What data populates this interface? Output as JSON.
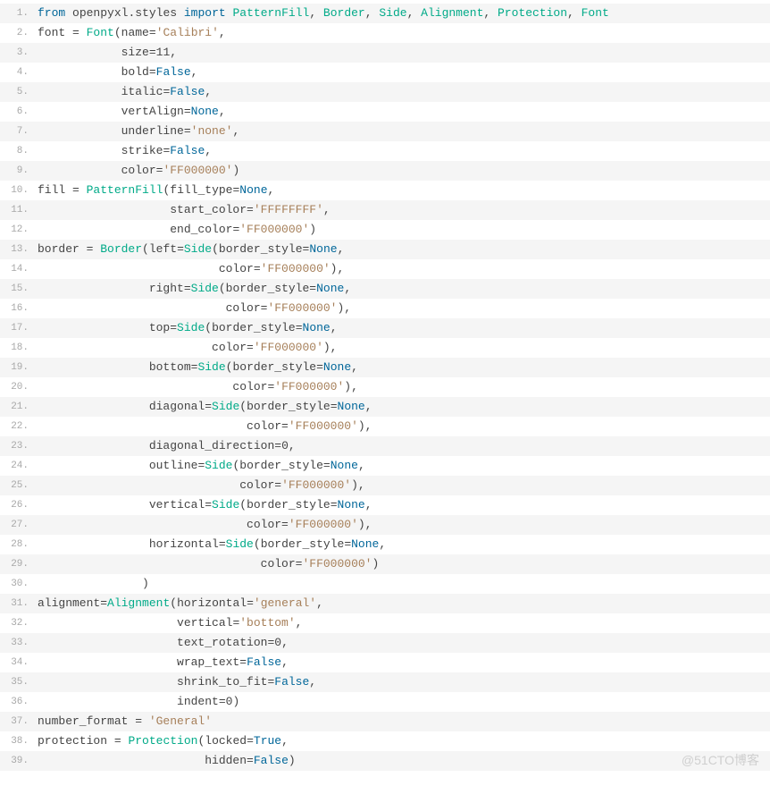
{
  "watermark": "@51CTO博客",
  "lines": [
    [
      [
        "kw",
        "from"
      ],
      [
        "id",
        " openpyxl"
      ],
      [
        "op",
        "."
      ],
      [
        "id",
        "styles "
      ],
      [
        "kw",
        "import"
      ],
      [
        "id",
        " "
      ],
      [
        "cls",
        "PatternFill"
      ],
      [
        "op",
        ", "
      ],
      [
        "cls",
        "Border"
      ],
      [
        "op",
        ", "
      ],
      [
        "cls",
        "Side"
      ],
      [
        "op",
        ", "
      ],
      [
        "cls",
        "Alignment"
      ],
      [
        "op",
        ", "
      ],
      [
        "cls",
        "Protection"
      ],
      [
        "op",
        ", "
      ],
      [
        "cls",
        "Font"
      ]
    ],
    [
      [
        "id",
        "font "
      ],
      [
        "op",
        "= "
      ],
      [
        "cls",
        "Font"
      ],
      [
        "op",
        "("
      ],
      [
        "id",
        "name"
      ],
      [
        "op",
        "="
      ],
      [
        "str",
        "'Calibri'"
      ],
      [
        "op",
        ","
      ]
    ],
    [
      [
        "id",
        "            size"
      ],
      [
        "op",
        "="
      ],
      [
        "num",
        "11"
      ],
      [
        "op",
        ","
      ]
    ],
    [
      [
        "id",
        "            bold"
      ],
      [
        "op",
        "="
      ],
      [
        "bool",
        "False"
      ],
      [
        "op",
        ","
      ]
    ],
    [
      [
        "id",
        "            italic"
      ],
      [
        "op",
        "="
      ],
      [
        "bool",
        "False"
      ],
      [
        "op",
        ","
      ]
    ],
    [
      [
        "id",
        "            vertAlign"
      ],
      [
        "op",
        "="
      ],
      [
        "bool",
        "None"
      ],
      [
        "op",
        ","
      ]
    ],
    [
      [
        "id",
        "            underline"
      ],
      [
        "op",
        "="
      ],
      [
        "str",
        "'none'"
      ],
      [
        "op",
        ","
      ]
    ],
    [
      [
        "id",
        "            strike"
      ],
      [
        "op",
        "="
      ],
      [
        "bool",
        "False"
      ],
      [
        "op",
        ","
      ]
    ],
    [
      [
        "id",
        "            color"
      ],
      [
        "op",
        "="
      ],
      [
        "str",
        "'FF000000'"
      ],
      [
        "op",
        ")"
      ]
    ],
    [
      [
        "id",
        "fill "
      ],
      [
        "op",
        "= "
      ],
      [
        "cls",
        "PatternFill"
      ],
      [
        "op",
        "("
      ],
      [
        "id",
        "fill_type"
      ],
      [
        "op",
        "="
      ],
      [
        "bool",
        "None"
      ],
      [
        "op",
        ","
      ]
    ],
    [
      [
        "id",
        "                   start_color"
      ],
      [
        "op",
        "="
      ],
      [
        "str",
        "'FFFFFFFF'"
      ],
      [
        "op",
        ","
      ]
    ],
    [
      [
        "id",
        "                   end_color"
      ],
      [
        "op",
        "="
      ],
      [
        "str",
        "'FF000000'"
      ],
      [
        "op",
        ")"
      ]
    ],
    [
      [
        "id",
        "border "
      ],
      [
        "op",
        "= "
      ],
      [
        "cls",
        "Border"
      ],
      [
        "op",
        "("
      ],
      [
        "id",
        "left"
      ],
      [
        "op",
        "="
      ],
      [
        "cls",
        "Side"
      ],
      [
        "op",
        "("
      ],
      [
        "id",
        "border_style"
      ],
      [
        "op",
        "="
      ],
      [
        "bool",
        "None"
      ],
      [
        "op",
        ","
      ]
    ],
    [
      [
        "id",
        "                          color"
      ],
      [
        "op",
        "="
      ],
      [
        "str",
        "'FF000000'"
      ],
      [
        "op",
        "),"
      ]
    ],
    [
      [
        "id",
        "                right"
      ],
      [
        "op",
        "="
      ],
      [
        "cls",
        "Side"
      ],
      [
        "op",
        "("
      ],
      [
        "id",
        "border_style"
      ],
      [
        "op",
        "="
      ],
      [
        "bool",
        "None"
      ],
      [
        "op",
        ","
      ]
    ],
    [
      [
        "id",
        "                           color"
      ],
      [
        "op",
        "="
      ],
      [
        "str",
        "'FF000000'"
      ],
      [
        "op",
        "),"
      ]
    ],
    [
      [
        "id",
        "                top"
      ],
      [
        "op",
        "="
      ],
      [
        "cls",
        "Side"
      ],
      [
        "op",
        "("
      ],
      [
        "id",
        "border_style"
      ],
      [
        "op",
        "="
      ],
      [
        "bool",
        "None"
      ],
      [
        "op",
        ","
      ]
    ],
    [
      [
        "id",
        "                         color"
      ],
      [
        "op",
        "="
      ],
      [
        "str",
        "'FF000000'"
      ],
      [
        "op",
        "),"
      ]
    ],
    [
      [
        "id",
        "                bottom"
      ],
      [
        "op",
        "="
      ],
      [
        "cls",
        "Side"
      ],
      [
        "op",
        "("
      ],
      [
        "id",
        "border_style"
      ],
      [
        "op",
        "="
      ],
      [
        "bool",
        "None"
      ],
      [
        "op",
        ","
      ]
    ],
    [
      [
        "id",
        "                            color"
      ],
      [
        "op",
        "="
      ],
      [
        "str",
        "'FF000000'"
      ],
      [
        "op",
        "),"
      ]
    ],
    [
      [
        "id",
        "                diagonal"
      ],
      [
        "op",
        "="
      ],
      [
        "cls",
        "Side"
      ],
      [
        "op",
        "("
      ],
      [
        "id",
        "border_style"
      ],
      [
        "op",
        "="
      ],
      [
        "bool",
        "None"
      ],
      [
        "op",
        ","
      ]
    ],
    [
      [
        "id",
        "                              color"
      ],
      [
        "op",
        "="
      ],
      [
        "str",
        "'FF000000'"
      ],
      [
        "op",
        "),"
      ]
    ],
    [
      [
        "id",
        "                diagonal_direction"
      ],
      [
        "op",
        "="
      ],
      [
        "num",
        "0"
      ],
      [
        "op",
        ","
      ]
    ],
    [
      [
        "id",
        "                outline"
      ],
      [
        "op",
        "="
      ],
      [
        "cls",
        "Side"
      ],
      [
        "op",
        "("
      ],
      [
        "id",
        "border_style"
      ],
      [
        "op",
        "="
      ],
      [
        "bool",
        "None"
      ],
      [
        "op",
        ","
      ]
    ],
    [
      [
        "id",
        "                             color"
      ],
      [
        "op",
        "="
      ],
      [
        "str",
        "'FF000000'"
      ],
      [
        "op",
        "),"
      ]
    ],
    [
      [
        "id",
        "                vertical"
      ],
      [
        "op",
        "="
      ],
      [
        "cls",
        "Side"
      ],
      [
        "op",
        "("
      ],
      [
        "id",
        "border_style"
      ],
      [
        "op",
        "="
      ],
      [
        "bool",
        "None"
      ],
      [
        "op",
        ","
      ]
    ],
    [
      [
        "id",
        "                              color"
      ],
      [
        "op",
        "="
      ],
      [
        "str",
        "'FF000000'"
      ],
      [
        "op",
        "),"
      ]
    ],
    [
      [
        "id",
        "                horizontal"
      ],
      [
        "op",
        "="
      ],
      [
        "cls",
        "Side"
      ],
      [
        "op",
        "("
      ],
      [
        "id",
        "border_style"
      ],
      [
        "op",
        "="
      ],
      [
        "bool",
        "None"
      ],
      [
        "op",
        ","
      ]
    ],
    [
      [
        "id",
        "                                color"
      ],
      [
        "op",
        "="
      ],
      [
        "str",
        "'FF000000'"
      ],
      [
        "op",
        ")"
      ]
    ],
    [
      [
        "id",
        "               "
      ],
      [
        "op",
        ")"
      ]
    ],
    [
      [
        "id",
        "alignment"
      ],
      [
        "op",
        "="
      ],
      [
        "cls",
        "Alignment"
      ],
      [
        "op",
        "("
      ],
      [
        "id",
        "horizontal"
      ],
      [
        "op",
        "="
      ],
      [
        "str",
        "'general'"
      ],
      [
        "op",
        ","
      ]
    ],
    [
      [
        "id",
        "                    vertical"
      ],
      [
        "op",
        "="
      ],
      [
        "str",
        "'bottom'"
      ],
      [
        "op",
        ","
      ]
    ],
    [
      [
        "id",
        "                    text_rotation"
      ],
      [
        "op",
        "="
      ],
      [
        "num",
        "0"
      ],
      [
        "op",
        ","
      ]
    ],
    [
      [
        "id",
        "                    wrap_text"
      ],
      [
        "op",
        "="
      ],
      [
        "bool",
        "False"
      ],
      [
        "op",
        ","
      ]
    ],
    [
      [
        "id",
        "                    shrink_to_fit"
      ],
      [
        "op",
        "="
      ],
      [
        "bool",
        "False"
      ],
      [
        "op",
        ","
      ]
    ],
    [
      [
        "id",
        "                    indent"
      ],
      [
        "op",
        "="
      ],
      [
        "num",
        "0"
      ],
      [
        "op",
        ")"
      ]
    ],
    [
      [
        "id",
        "number_format "
      ],
      [
        "op",
        "= "
      ],
      [
        "str",
        "'General'"
      ]
    ],
    [
      [
        "id",
        "protection "
      ],
      [
        "op",
        "= "
      ],
      [
        "cls",
        "Protection"
      ],
      [
        "op",
        "("
      ],
      [
        "id",
        "locked"
      ],
      [
        "op",
        "="
      ],
      [
        "bool",
        "True"
      ],
      [
        "op",
        ","
      ]
    ],
    [
      [
        "id",
        "                        hidden"
      ],
      [
        "op",
        "="
      ],
      [
        "bool",
        "False"
      ],
      [
        "op",
        ")"
      ]
    ]
  ]
}
